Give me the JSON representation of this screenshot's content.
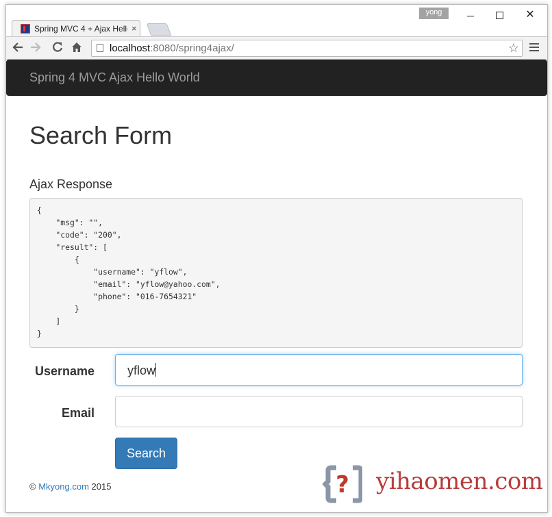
{
  "browser": {
    "tab_title": "Spring MVC 4 + Ajax Hello",
    "tab_close": "×",
    "profile": "yong",
    "window_close": "✕",
    "url_host": "localhost",
    "url_rest": ":8080/spring4ajax/",
    "icons": [
      "favicon-icon",
      "back-icon",
      "forward-icon",
      "reload-icon",
      "home-icon",
      "page-icon",
      "star-icon",
      "menu-icon"
    ]
  },
  "page": {
    "brand": "Spring 4 MVC Ajax Hello World",
    "title": "Search Form",
    "response_heading": "Ajax Response",
    "response_json": "{\n    \"msg\": \"\",\n    \"code\": \"200\",\n    \"result\": [\n        {\n            \"username\": \"yflow\",\n            \"email\": \"yflow@yahoo.com\",\n            \"phone\": \"016-7654321\"\n        }\n    ]\n}",
    "form": {
      "username_label": "Username",
      "username_value": "yflow",
      "email_label": "Email",
      "email_value": "",
      "search_label": "Search"
    },
    "footer": {
      "prefix": "©",
      "link": "Mkyong.com",
      "year": "2015"
    },
    "colors": {
      "navbar": "#222222",
      "primary_button": "#337ab7",
      "focus_border": "#66afe9",
      "watermark": "#b73c3c"
    }
  },
  "watermark": {
    "text": "yihaomen.com"
  }
}
